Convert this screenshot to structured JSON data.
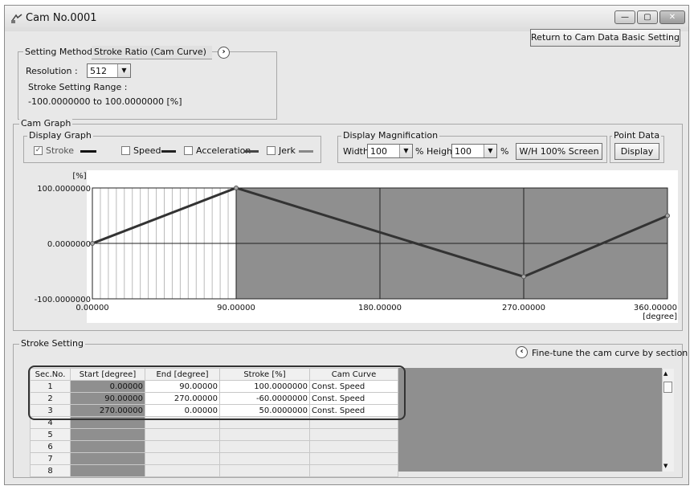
{
  "window": {
    "title": "Cam No.0001",
    "min_symbol": "—",
    "max_symbol": "▢",
    "close_symbol": "✕"
  },
  "return_button": "Return to Cam Data Basic Setting",
  "setting": {
    "method_label": "Setting Method :",
    "method_value": "Stroke Ratio (Cam Curve)",
    "expand_symbol": "›",
    "resolution_label": "Resolution :",
    "resolution_value": "512",
    "range_label": "Stroke Setting Range :",
    "range_value": "-100.0000000 to  100.0000000 [%]"
  },
  "cam_graph": {
    "group_label": "Cam Graph",
    "display_graph_label": "Display Graph",
    "stroke_label": "Stroke",
    "speed_label": "Speed",
    "accel_label": "Acceleration",
    "jerk_label": "Jerk",
    "stroke_checked": true,
    "check_mark": "✓",
    "magnification_label": "Display Magnification",
    "width_label": "Width",
    "width_value": "100",
    "percent": "%",
    "height_label": "Height",
    "height_value": "100",
    "wh_button": "W/H 100% Screen",
    "point_data_label": "Point Data",
    "display_button": "Display"
  },
  "chart_data": {
    "type": "line",
    "ylabel": "[%]",
    "xlabel": "[degree]",
    "y_ticks": [
      "100.0000000",
      "0.0000000",
      "-100.0000000"
    ],
    "x_ticks": [
      "0.00000",
      "90.00000",
      "180.00000",
      "270.00000",
      "360.00000"
    ],
    "xlim": [
      0,
      360
    ],
    "ylim": [
      -100,
      100
    ],
    "series": [
      {
        "x": [
          0,
          90,
          270,
          360
        ],
        "y": [
          0,
          100,
          -60,
          50
        ]
      }
    ],
    "selected_section": [
      0,
      90
    ]
  },
  "stroke_setting": {
    "group_label": "Stroke Setting",
    "fine_tune_symbol": "‹",
    "fine_tune_label": "Fine-tune the cam curve by section",
    "columns": [
      "Sec.No.",
      "Start [degree]",
      "End [degree]",
      "Stroke [%]",
      "Cam Curve"
    ],
    "rows": [
      [
        "1",
        "0.00000",
        "90.00000",
        "100.0000000",
        "Const. Speed"
      ],
      [
        "2",
        "90.00000",
        "270.00000",
        "-60.0000000",
        "Const. Speed"
      ],
      [
        "3",
        "270.00000",
        "0.00000",
        "50.0000000",
        "Const. Speed"
      ],
      [
        "4",
        "",
        "",
        "",
        ""
      ],
      [
        "5",
        "",
        "",
        "",
        ""
      ],
      [
        "6",
        "",
        "",
        "",
        ""
      ],
      [
        "7",
        "",
        "",
        "",
        ""
      ],
      [
        "8",
        "",
        "",
        "",
        ""
      ]
    ],
    "scroll_up": "▲",
    "scroll_down": "▼"
  }
}
